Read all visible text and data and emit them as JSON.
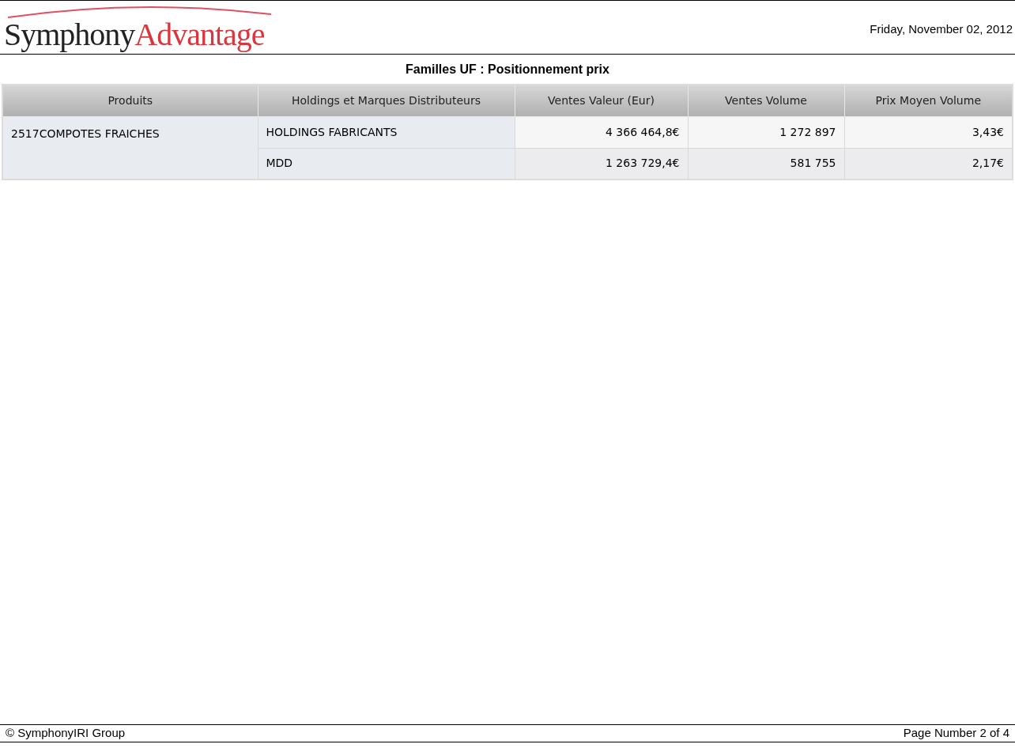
{
  "logo": {
    "part_1": "Symphony",
    "part_2": "Advantage"
  },
  "date": "Friday, November 02, 2012",
  "report_title": "Familles UF : Positionnement prix",
  "table": {
    "columns": [
      "Produits",
      "Holdings et Marques Distributeurs",
      "Ventes Valeur (Eur)",
      "Ventes Volume",
      "Prix Moyen Volume"
    ],
    "groups": [
      {
        "product": "2517COMPOTES FRAICHES",
        "rows": [
          {
            "holding": "HOLDINGS FABRICANTS",
            "ventes_valeur": "4 366 464,8€",
            "ventes_volume": "1 272 897",
            "prix_moyen": "3,43€"
          },
          {
            "holding": "MDD",
            "ventes_valeur": "1 263 729,4€",
            "ventes_volume": "581 755",
            "prix_moyen": "2,17€"
          }
        ]
      }
    ]
  },
  "footer": {
    "copyright": "© SymphonyIRI Group",
    "page_number": "Page Number 2 of 4"
  }
}
